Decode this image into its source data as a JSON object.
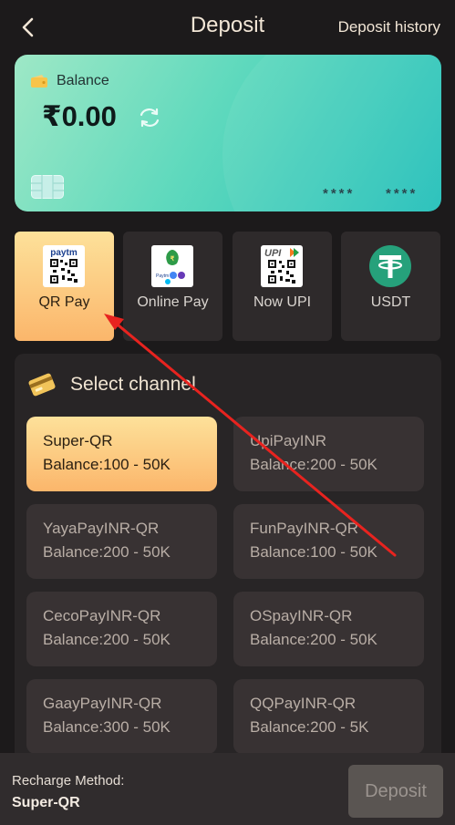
{
  "header": {
    "title": "Deposit",
    "history_label": "Deposit history",
    "back_icon": "chevron-left-icon"
  },
  "card": {
    "balance_label": "Balance",
    "balance_amount": "₹0.00",
    "card_number_group1": "****",
    "card_number_group2": "****"
  },
  "methods": [
    {
      "label": "QR Pay",
      "icon": "paytm-qr-icon",
      "active": true
    },
    {
      "label": "Online Pay",
      "icon": "online-pay-icon",
      "active": false
    },
    {
      "label": "Now UPI",
      "icon": "upi-qr-icon",
      "active": false
    },
    {
      "label": "USDT",
      "icon": "tether-icon",
      "active": false
    }
  ],
  "channel_panel": {
    "title": "Select channel",
    "channels": [
      {
        "name": "Super-QR",
        "range": "Balance:100 - 50K",
        "active": true
      },
      {
        "name": "UpiPayINR",
        "range": "Balance:200 - 50K",
        "active": false
      },
      {
        "name": "YayaPayINR-QR",
        "range": "Balance:200 - 50K",
        "active": false
      },
      {
        "name": "FunPayINR-QR",
        "range": "Balance:100 - 50K",
        "active": false
      },
      {
        "name": "CecoPayINR-QR",
        "range": "Balance:200 - 50K",
        "active": false
      },
      {
        "name": "OSpayINR-QR",
        "range": "Balance:200 - 50K",
        "active": false
      },
      {
        "name": "GaayPayINR-QR",
        "range": "Balance:300 - 50K",
        "active": false
      },
      {
        "name": "QQPayINR-QR",
        "range": "Balance:200 - 5K",
        "active": false
      }
    ]
  },
  "footer": {
    "recharge_method_label": "Recharge Method:",
    "recharge_method_value": "Super-QR",
    "deposit_button": "Deposit"
  },
  "colors": {
    "background": "#1c1a1b",
    "active_gradient_top": "#fde19a",
    "active_gradient_bottom": "#fbb66b",
    "card_gradient_start": "#9ee8c6",
    "card_gradient_end": "#22bfb9",
    "annotation_arrow": "#e8231f"
  }
}
